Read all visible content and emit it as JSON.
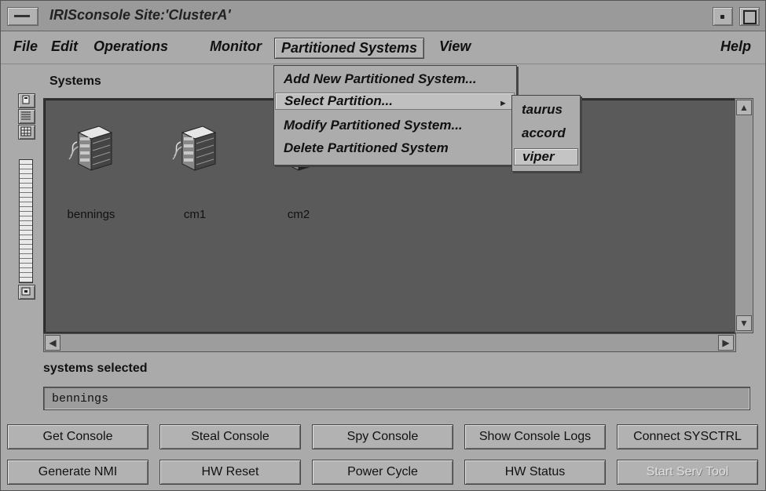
{
  "window": {
    "title": "IRISconsole Site:'ClusterA'"
  },
  "menubar": {
    "file": "File",
    "edit": "Edit",
    "operations": "Operations",
    "monitor": "Monitor",
    "partitioned_systems": "Partitioned Systems",
    "view": "View",
    "help": "Help"
  },
  "partitioned_menu": {
    "items": [
      "Add New Partitioned System...",
      "Select Partition...",
      "Modify Partitioned System...",
      "Delete Partitioned System"
    ]
  },
  "partition_submenu": {
    "items": [
      "taurus",
      "accord",
      "viper"
    ]
  },
  "systems": {
    "label": "Systems",
    "icons": [
      {
        "name": "bennings"
      },
      {
        "name": "cm1"
      },
      {
        "name": "cm2"
      }
    ]
  },
  "selection": {
    "label": "systems selected",
    "value": "bennings"
  },
  "buttons": {
    "row1": [
      "Get Console",
      "Steal Console",
      "Spy Console",
      "Show Console Logs",
      "Connect SYSCTRL"
    ],
    "row2": [
      "Generate NMI",
      "HW Reset",
      "Power Cycle",
      "HW Status",
      "Start Serv Tool"
    ]
  },
  "icons": {
    "window_menu": "window-menu-icon",
    "minimize": "minimize-icon",
    "maximize": "maximize-icon",
    "server": "server-icon",
    "scroll_up": "arrow-up-icon",
    "scroll_down": "arrow-down-icon",
    "scroll_left": "arrow-left-icon",
    "scroll_right": "arrow-right-icon",
    "submenu": "submenu-arrow-icon"
  }
}
